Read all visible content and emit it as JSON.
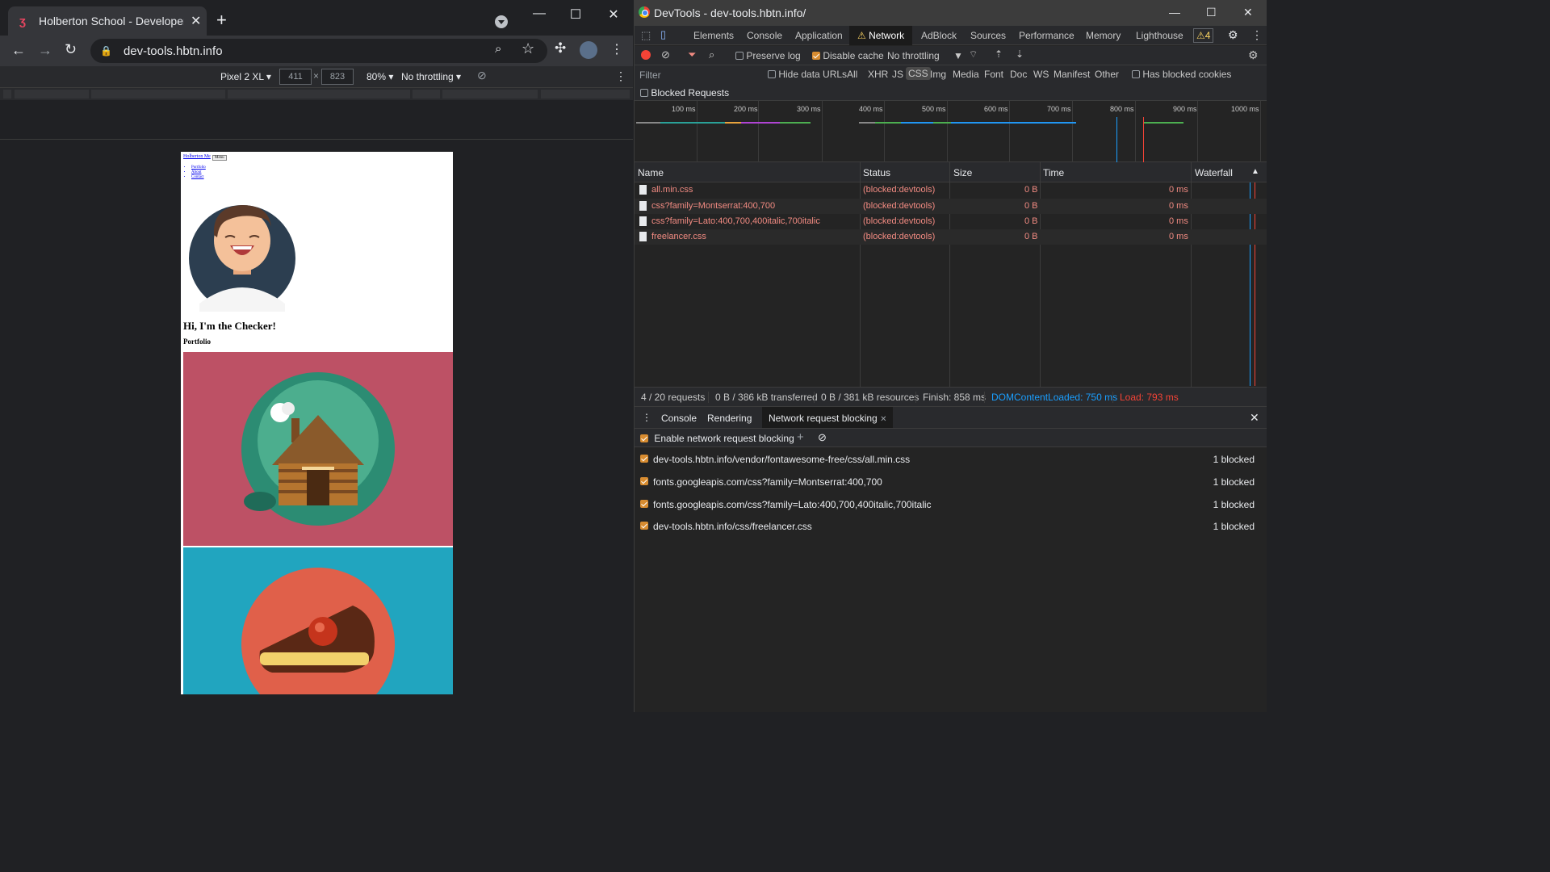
{
  "browser": {
    "tab_title": "Holberton School - Developer to",
    "url": "dev-tools.hbtn.info",
    "device": "Pixel 2 XL",
    "width": "411",
    "height": "823",
    "zoom": "80%",
    "throttling": "No throttling"
  },
  "mobile_page": {
    "brand": "Holberton Me",
    "menu_label": "Menu",
    "nav": [
      "Portfolio",
      "About",
      "Contact"
    ],
    "heading": "Hi, I'm the Checker!",
    "subheading": "Portfolio",
    "colors": {
      "card1": "#bd5165",
      "card2": "#21a5bf"
    }
  },
  "devtools": {
    "window_title": "DevTools - dev-tools.hbtn.info/",
    "tabs": [
      "Elements",
      "Console",
      "Application",
      "Network",
      "AdBlock",
      "Sources",
      "Performance",
      "Memory",
      "Lighthouse"
    ],
    "active_tab": "Network",
    "warnings": "4",
    "toolbar": {
      "preserve_log": "Preserve log",
      "disable_cache": "Disable cache",
      "throttling": "No throttling"
    },
    "filter": {
      "placeholder": "Filter",
      "hide_data_urls": "Hide data URLs",
      "types": [
        "All",
        "XHR",
        "JS",
        "CSS",
        "Img",
        "Media",
        "Font",
        "Doc",
        "WS",
        "Manifest",
        "Other"
      ],
      "active_type": "CSS",
      "has_blocked_cookies": "Has blocked cookies",
      "blocked_requests": "Blocked Requests"
    },
    "timeline_ticks": [
      "100 ms",
      "200 ms",
      "300 ms",
      "400 ms",
      "500 ms",
      "600 ms",
      "700 ms",
      "800 ms",
      "900 ms",
      "1000 ms"
    ],
    "columns": [
      "Name",
      "Status",
      "Size",
      "Time",
      "Waterfall"
    ],
    "rows": [
      {
        "name": "all.min.css",
        "status": "(blocked:devtools)",
        "size": "0 B",
        "time": "0 ms"
      },
      {
        "name": "css?family=Montserrat:400,700",
        "status": "(blocked:devtools)",
        "size": "0 B",
        "time": "0 ms"
      },
      {
        "name": "css?family=Lato:400,700,400italic,700italic",
        "status": "(blocked:devtools)",
        "size": "0 B",
        "time": "0 ms"
      },
      {
        "name": "freelancer.css",
        "status": "(blocked:devtools)",
        "size": "0 B",
        "time": "0 ms"
      }
    ],
    "summary": {
      "requests": "4 / 20 requests",
      "transferred": "0 B / 386 kB transferred",
      "resources": "0 B / 381 kB resources",
      "finish": "Finish: 858 ms",
      "dom": "DOMContentLoaded: 750 ms",
      "load": "Load: 793 ms"
    },
    "drawer_tabs": [
      "Console",
      "Rendering",
      "Network request blocking"
    ],
    "enable_blocking": "Enable network request blocking",
    "patterns": [
      {
        "url": "dev-tools.hbtn.info/vendor/fontawesome-free/css/all.min.css",
        "count": "1 blocked"
      },
      {
        "url": "fonts.googleapis.com/css?family=Montserrat:400,700",
        "count": "1 blocked"
      },
      {
        "url": "fonts.googleapis.com/css?family=Lato:400,700,400italic,700italic",
        "count": "1 blocked"
      },
      {
        "url": "dev-tools.hbtn.info/css/freelancer.css",
        "count": "1 blocked"
      }
    ],
    "colors": {
      "accent_dom": "#1a9fff",
      "accent_load": "#f44336",
      "blocked_text": "#f28b82"
    }
  }
}
